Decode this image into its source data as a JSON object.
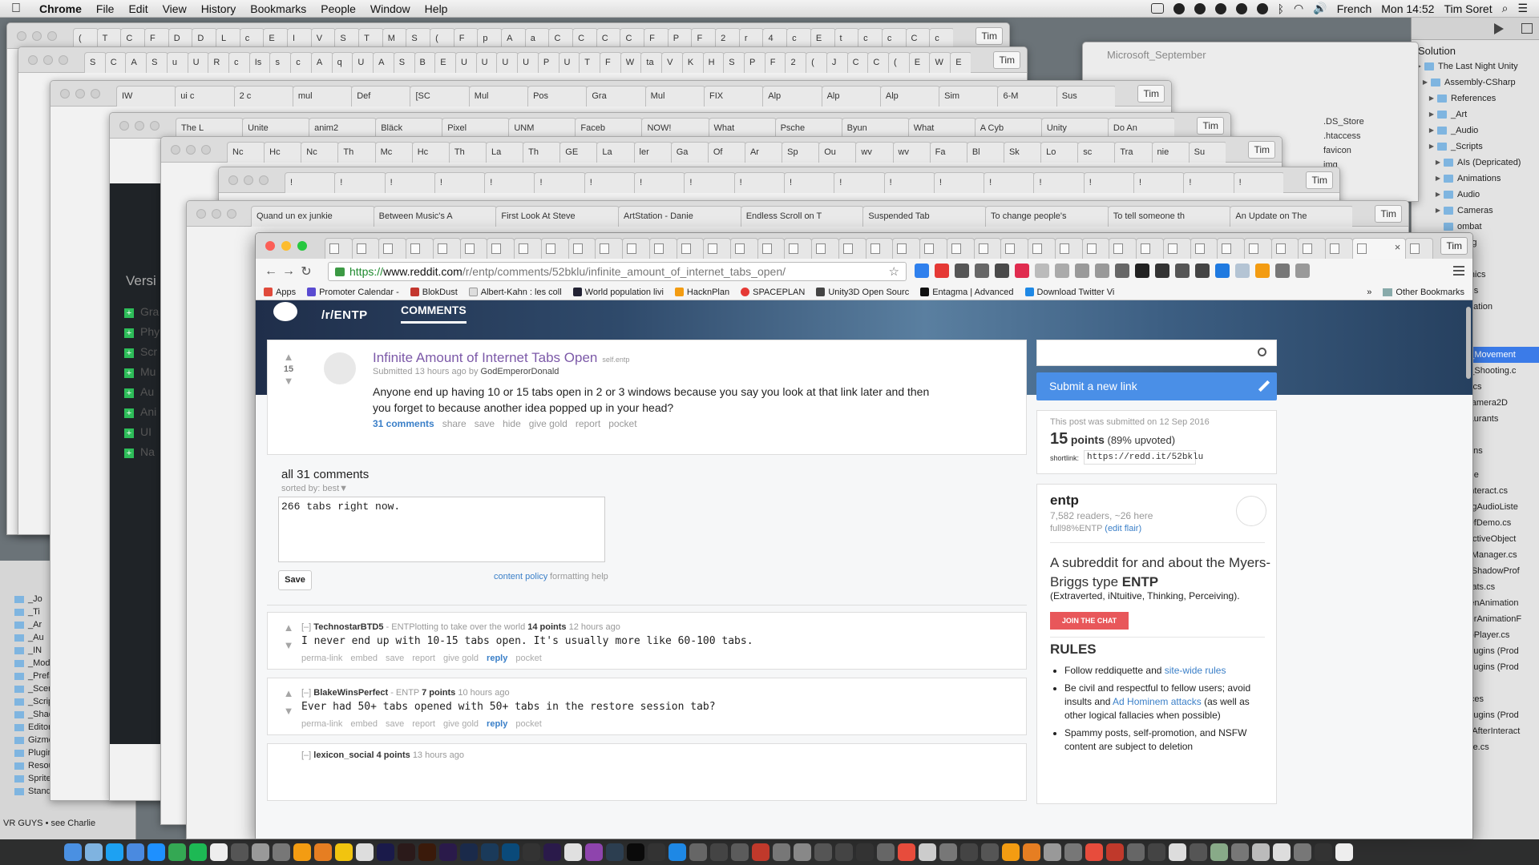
{
  "menubar": {
    "app": "Chrome",
    "items": [
      "File",
      "Edit",
      "View",
      "History",
      "Bookmarks",
      "People",
      "Window",
      "Help"
    ],
    "input_source": "French",
    "clock": "Mon 14:52",
    "user": "Tim Soret"
  },
  "bg_windows": [
    {
      "tabs": [
        "(",
        "T",
        "C",
        "F",
        "D",
        "D",
        "L",
        "c",
        "E",
        "I",
        "V",
        "S",
        "T",
        "M",
        "S",
        "(",
        "F",
        "p",
        "A",
        "a",
        "C",
        "C",
        "C",
        "C",
        "F",
        "P",
        "F",
        "2",
        "r",
        "4",
        "c",
        "E",
        "t",
        "c",
        "c",
        "C",
        "c"
      ],
      "user": "Tim"
    },
    {
      "tabs": [
        "S",
        "C",
        "A",
        "S",
        "u",
        "U",
        "R",
        "c",
        "Is",
        "s",
        "c",
        "A",
        "q",
        "U",
        "A",
        "S",
        "B",
        "E",
        "U",
        "U",
        "U",
        "U",
        "P",
        "U",
        "T",
        "F",
        "W",
        "ta",
        "V",
        "K",
        "H",
        "S",
        "P",
        "F",
        "2",
        "(",
        "J",
        "C",
        "C",
        "(",
        "E",
        "W",
        "E"
      ],
      "user": "Tim"
    },
    {
      "tabs": [
        "IW",
        "ui c",
        "2 c",
        "mul",
        "Def",
        "[SC",
        "Mul",
        "Pos",
        "Gra",
        "Mul",
        "FIX",
        "Alp",
        "Alp",
        "Alp",
        "Sim",
        "6-M",
        "Sus"
      ],
      "user": "Tim"
    },
    {
      "tabs": [
        "The L",
        "Unite",
        "anim2",
        "Bläck",
        "Pixel",
        "UNM",
        "Faceb",
        "NOW!",
        "What",
        "Psche",
        "Byun",
        "What",
        "A Cyb",
        "Unity",
        "Do An"
      ],
      "user": "Tim"
    },
    {
      "tabs": [
        "Nc",
        "Hc",
        "Nc",
        "Th",
        "Mc",
        "Hc",
        "Th",
        "La",
        "Th",
        "GE",
        "La",
        "ler",
        "Ga",
        "Of",
        "Ar",
        "Sp",
        "Ou",
        "wv",
        "wv",
        "Fa",
        "Bl",
        "Sk",
        "Lo",
        "sc",
        "Tra",
        "nie",
        "Su"
      ],
      "user": "Tim"
    },
    {
      "tabs": [
        "!",
        "!",
        "!",
        "!",
        "!",
        "!",
        "!",
        "!",
        "!",
        "!",
        "!",
        "!",
        "!",
        "!",
        "!",
        "!",
        "!",
        "!",
        "!",
        "!"
      ],
      "user": "Tim"
    },
    {
      "tabs": [
        "Quand un ex junkie",
        "Between Music's A",
        "First Look At Steve",
        "ArtStation - Danie",
        "Endless Scroll on T",
        "Suspended Tab",
        "To change people's",
        "To tell someone th",
        "An Update on The"
      ],
      "user": "Tim"
    }
  ],
  "finder": {
    "folder": "Microsoft_September",
    "items": [
      ".DS_Store",
      ".htaccess",
      "favicon",
      "img"
    ]
  },
  "unity_left": {
    "section": "Versi",
    "list": [
      "Gra",
      "Phy",
      "Scr",
      "Mu",
      "Au",
      "Ani",
      "UI",
      "Na"
    ],
    "assets": [
      "_Jo",
      "_Ti",
      "_Ar",
      "_Au",
      "_IN",
      "_Models",
      "_Prefabs",
      "_Scenes",
      "_Scripts",
      "_Shaders",
      "Editor",
      "Gizmos",
      "Plugins",
      "Resources",
      "SpriteSharp",
      "Standard Assets"
    ],
    "status": "VR GUYS • see Charlie",
    "script": "_Script"
  },
  "unity_right": {
    "title": "Solution",
    "tree": [
      "The Last Night Unity",
      "Assembly-CSharp",
      "References",
      "_Art",
      "_Audio",
      "_Scripts",
      "AIs (Depricated)",
      "Animations",
      "Audio",
      "Cameras",
      "ombat",
      "ebug",
      "Ms",
      "raphics",
      "lenus",
      "avigation",
      "PC",
      "C",
      "PC_Movement",
      "PC_Shooting.c",
      "hysics",
      "roCamera2D",
      "estaurants",
      "ools",
      "weens",
      "",
      "nique",
      "edInteract.cs",
      "ebugAudioListe",
      "ndOfDemo.cs",
      "teractiveObject",
      "ightManager.cs",
      "ightShadowProf",
      "CStats.cs",
      "creenAnimation",
      "iggerAnimationF",
      "ideoPlayer.cs",
      "'s Plugins (Prod",
      "'s Plugins (Prod",
      "ins",
      "ources",
      "'s Plugins (Prod",
      "troyAfterInteract",
      "State.cs"
    ],
    "selected": "PC_Movement"
  },
  "browser": {
    "user": "Tim",
    "url_scheme": "https://",
    "url_domain": "www.reddit.com",
    "url_path": "/r/entp/comments/52bklu/infinite_amount_of_internet_tabs_open/",
    "bookmarks": [
      "Apps",
      "Promoter Calendar -",
      "BlokDust",
      "Albert-Kahn : les coll",
      "World population livi",
      "HacknPlan",
      "SPACEPLAN",
      "Unity3D Open Sourc",
      "Entagma | Advanced",
      "Download Twitter Vi"
    ],
    "bookmarks_more": "»",
    "other_bookmarks": "Other Bookmarks"
  },
  "reddit": {
    "subreddit": "/r/ENTP",
    "tab": "COMMENTS",
    "post": {
      "score": "15",
      "title": "Infinite Amount of Internet Tabs Open",
      "domain": "self.entp",
      "submitted": "Submitted 13 hours ago by",
      "author": "GodEmperorDonald",
      "body": "Anyone end up having 10 or 15 tabs open in 2 or 3 windows because you say you look at that link later and then you forget to because another idea popped up in your head?",
      "actions": [
        "31 comments",
        "share",
        "save",
        "hide",
        "give gold",
        "report",
        "pocket"
      ]
    },
    "comments_header": "all 31 comments",
    "sorted_by": "sorted by: best▼",
    "draft": "266 tabs right now.",
    "save_label": "Save",
    "content_policy": "content policy",
    "formatting_help": "formatting help",
    "comments": [
      {
        "author": "TechnostarBTD5",
        "flair": "ENTPlotting to take over the world",
        "points": "14 points",
        "age": "12 hours ago",
        "text": "I never end up with 10-15 tabs open. It's usually more like 60-100 tabs."
      },
      {
        "author": "BlakeWinsPerfect",
        "flair": "ENTP",
        "points": "7 points",
        "age": "10 hours ago",
        "text": "Ever had 50+ tabs opened with 50+ tabs in the restore session tab?"
      },
      {
        "author": "lexicon_social",
        "flair": "",
        "points": "4 points",
        "age": "13 hours ago",
        "text": ""
      }
    ],
    "comment_actions": [
      "perma-link",
      "embed",
      "save",
      "report",
      "give gold",
      "reply",
      "pocket"
    ],
    "sidebar": {
      "submit": "Submit a new link",
      "submitted_on": "This post was submitted on 12 Sep 2016",
      "points": "15",
      "points_suffix": "points",
      "upvoted": "(89% upvoted)",
      "shortlink_label": "shortlink:",
      "shortlink": "https://redd.it/52bklu",
      "sub_name": "entp",
      "readers": "7,582 readers, ~26 here",
      "flair": "full98%ENTP",
      "edit_flair": "(edit flair)",
      "desc_1": "A subreddit for and about the Myers-Briggs type",
      "desc_type": "ENTP",
      "traits": "(Extraverted, iNtuitive, Thinking, Perceiving).",
      "join_chat": "JOIN THE CHAT",
      "rules_title": "RULES",
      "rules": [
        {
          "pre": "Follow reddiquette and ",
          "link": "site-wide rules",
          "post": ""
        },
        {
          "pre": "Be civil and respectful to fellow users; avoid insults and ",
          "link": "Ad Hominem attacks",
          "post": " (as well as other logical fallacies when possible)"
        },
        {
          "pre": "Spammy posts, self-promotion, and NSFW content are subject to deletion",
          "link": "",
          "post": ""
        }
      ]
    }
  }
}
